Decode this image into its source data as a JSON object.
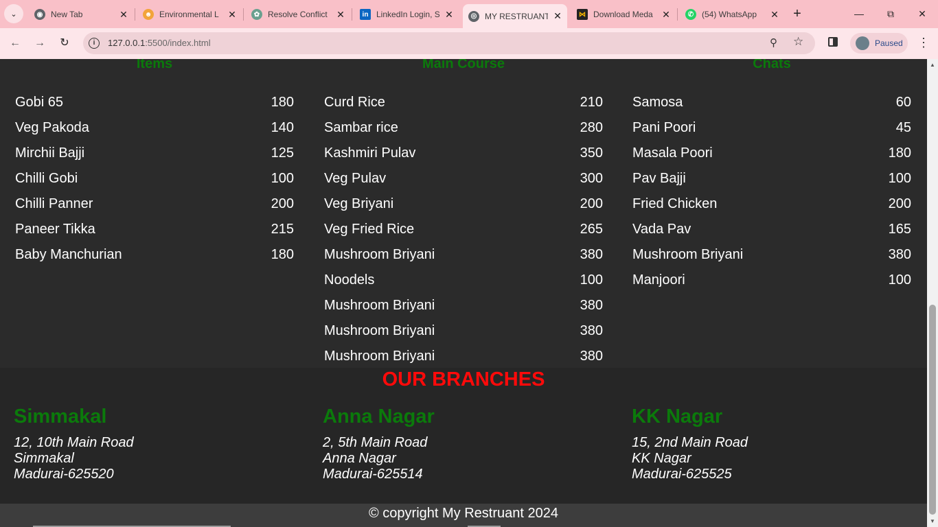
{
  "browser": {
    "tabs": [
      {
        "title": "New Tab",
        "icon": "chrome-icon",
        "color": "#5f6368"
      },
      {
        "title": "Environmental L",
        "icon": "people-icon",
        "color": "#f2a43a"
      },
      {
        "title": "Resolve Conflict",
        "icon": "openai-icon",
        "color": "#6aa08f"
      },
      {
        "title": "LinkedIn Login, S",
        "icon": "linkedin-icon",
        "color": "#0a66c2"
      },
      {
        "title": "MY RESTRUANT",
        "icon": "globe-icon",
        "color": "#5f6368"
      },
      {
        "title": "Download Meda",
        "icon": "media-icon",
        "color": "#f5b400"
      },
      {
        "title": "(54) WhatsApp",
        "icon": "whatsapp-icon",
        "color": "#25d366"
      }
    ],
    "active_tab_index": 4,
    "url_host": "127.0.0.1",
    "url_path": ":5500/index.html",
    "profile_label": "Paused"
  },
  "menu": {
    "columns": [
      {
        "heading": "Items",
        "items": [
          {
            "name": "Gobi 65",
            "price": "180"
          },
          {
            "name": "Veg Pakoda",
            "price": "140"
          },
          {
            "name": "Mirchii Bajji",
            "price": "125"
          },
          {
            "name": "Chilli Gobi",
            "price": "100"
          },
          {
            "name": "Chilli Panner",
            "price": "200"
          },
          {
            "name": "Paneer Tikka",
            "price": "215"
          },
          {
            "name": "Baby Manchurian",
            "price": "180"
          }
        ]
      },
      {
        "heading": "Main Course",
        "items": [
          {
            "name": "Curd Rice",
            "price": "210"
          },
          {
            "name": "Sambar rice",
            "price": "280"
          },
          {
            "name": "Kashmiri Pulav",
            "price": "350"
          },
          {
            "name": "Veg Pulav",
            "price": "300"
          },
          {
            "name": "Veg Briyani",
            "price": "200"
          },
          {
            "name": "Veg Fried Rice",
            "price": "265"
          },
          {
            "name": "Mushroom Briyani",
            "price": "380"
          },
          {
            "name": "Noodels",
            "price": "100"
          },
          {
            "name": "Mushroom Briyani",
            "price": "380"
          },
          {
            "name": "Mushroom Briyani",
            "price": "380"
          },
          {
            "name": "Mushroom Briyani",
            "price": "380"
          }
        ]
      },
      {
        "heading": "Chats",
        "items": [
          {
            "name": "Samosa",
            "price": "60"
          },
          {
            "name": "Pani Poori",
            "price": "45"
          },
          {
            "name": "Masala Poori",
            "price": "180"
          },
          {
            "name": "Pav Bajji",
            "price": "100"
          },
          {
            "name": "Fried Chicken",
            "price": "200"
          },
          {
            "name": "Vada Pav",
            "price": "165"
          },
          {
            "name": "Mushroom Briyani",
            "price": "380"
          },
          {
            "name": "Manjoori",
            "price": "100"
          }
        ]
      }
    ]
  },
  "branches": {
    "title": "OUR BRANCHES",
    "list": [
      {
        "name": "Simmakal",
        "line1": "12, 10th Main Road",
        "line2": "Simmakal",
        "line3": "Madurai-625520"
      },
      {
        "name": "Anna Nagar",
        "line1": "2, 5th Main Road",
        "line2": "Anna Nagar",
        "line3": "Madurai-625514"
      },
      {
        "name": "KK Nagar",
        "line1": "15, 2nd Main Road",
        "line2": "KK Nagar",
        "line3": "Madurai-625525"
      }
    ]
  },
  "footer": {
    "text": "© copyright My Restruant 2024"
  },
  "colors": {
    "heading_green": "#0b7a0b",
    "branches_red": "#ff0a0a",
    "page_bg": "#2b2b2b",
    "tabbar_bg": "#f9c0c8"
  }
}
